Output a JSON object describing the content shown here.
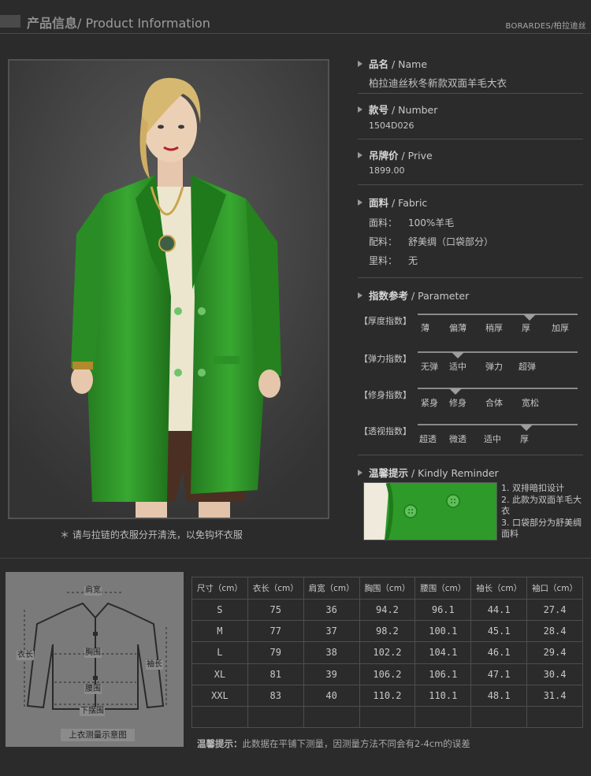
{
  "header": {
    "title_cn": "产品信息",
    "title_en": "/ Product Information",
    "brand": "BORARDES/柏拉迪丝"
  },
  "product": {
    "name_head_cn": "品名",
    "name_head_en": " / Name",
    "name_value": "柏拉迪丝秋冬新款双面羊毛大衣",
    "number_head_cn": "款号",
    "number_head_en": " / Number",
    "number_value": "1504D026",
    "price_head_cn": "吊牌价",
    "price_head_en": " / Prive",
    "price_value": "1899.00",
    "fabric_head_cn": "面料",
    "fabric_head_en": " / Fabric",
    "fabric_rows": [
      {
        "label": "面料：",
        "value": "100%羊毛"
      },
      {
        "label": "配料：",
        "value": "舒美绸（口袋部分）"
      },
      {
        "label": "里料：",
        "value": "无"
      }
    ]
  },
  "parameters": {
    "head_cn": "指数参考",
    "head_en": " / Parameter",
    "items": [
      {
        "label": "【厚度指数】",
        "options": [
          "薄",
          "偏薄",
          "稍厚",
          "厚",
          "加厚"
        ],
        "selected_index": 3
      },
      {
        "label": "【弹力指数】",
        "options": [
          "无弹",
          "适中",
          "弹力",
          "超弹"
        ],
        "selected_index": 1
      },
      {
        "label": "【修身指数】",
        "options": [
          "紧身",
          "修身",
          "合体",
          "宽松"
        ],
        "selected_index": 1
      },
      {
        "label": "【透视指数】",
        "options": [
          "超透",
          "微透",
          "适中",
          "厚"
        ],
        "selected_index": 3
      }
    ]
  },
  "reminder": {
    "head_cn": "温馨提示",
    "head_en": " / Kindly Reminder",
    "lines": [
      "1. 双排暗扣设计",
      "2. 此款为双面羊毛大衣",
      "3. 口袋部分为舒美绸面料"
    ]
  },
  "wash_note": "＊ 请与拉链的衣服分开清洗，以免钩坏衣服",
  "diagram": {
    "caption": "上衣测量示意图",
    "labels": {
      "shoulder": "肩宽",
      "length": "衣长",
      "chest": "胸围",
      "sleeve": "袖长",
      "waist": "腰围",
      "hem": "下摆围"
    }
  },
  "size_table": {
    "headers": [
      "尺寸（cm）",
      "衣长（cm）",
      "肩宽（cm）",
      "胸围（cm）",
      "腰围（cm）",
      "袖长（cm）",
      "袖口（cm）"
    ],
    "rows": [
      [
        "S",
        "75",
        "36",
        "94.2",
        "96.1",
        "44.1",
        "27.4"
      ],
      [
        "M",
        "77",
        "37",
        "98.2",
        "100.1",
        "45.1",
        "28.4"
      ],
      [
        "L",
        "79",
        "38",
        "102.2",
        "104.1",
        "46.1",
        "29.4"
      ],
      [
        "XL",
        "81",
        "39",
        "106.2",
        "106.1",
        "47.1",
        "30.4"
      ],
      [
        "XXL",
        "83",
        "40",
        "110.2",
        "110.1",
        "48.1",
        "31.4"
      ],
      [
        "",
        "",
        "",
        "",
        "",
        "",
        ""
      ]
    ]
  },
  "footer": {
    "tip_cn": "温馨提示：",
    "tip_text": "此数据在平铺下测量，因测量方法不同会有2-4cm的误差"
  },
  "colors": {
    "background": "#2b2b2b",
    "coat_green": "#2f9a2a",
    "text": "#c6c6c6"
  }
}
